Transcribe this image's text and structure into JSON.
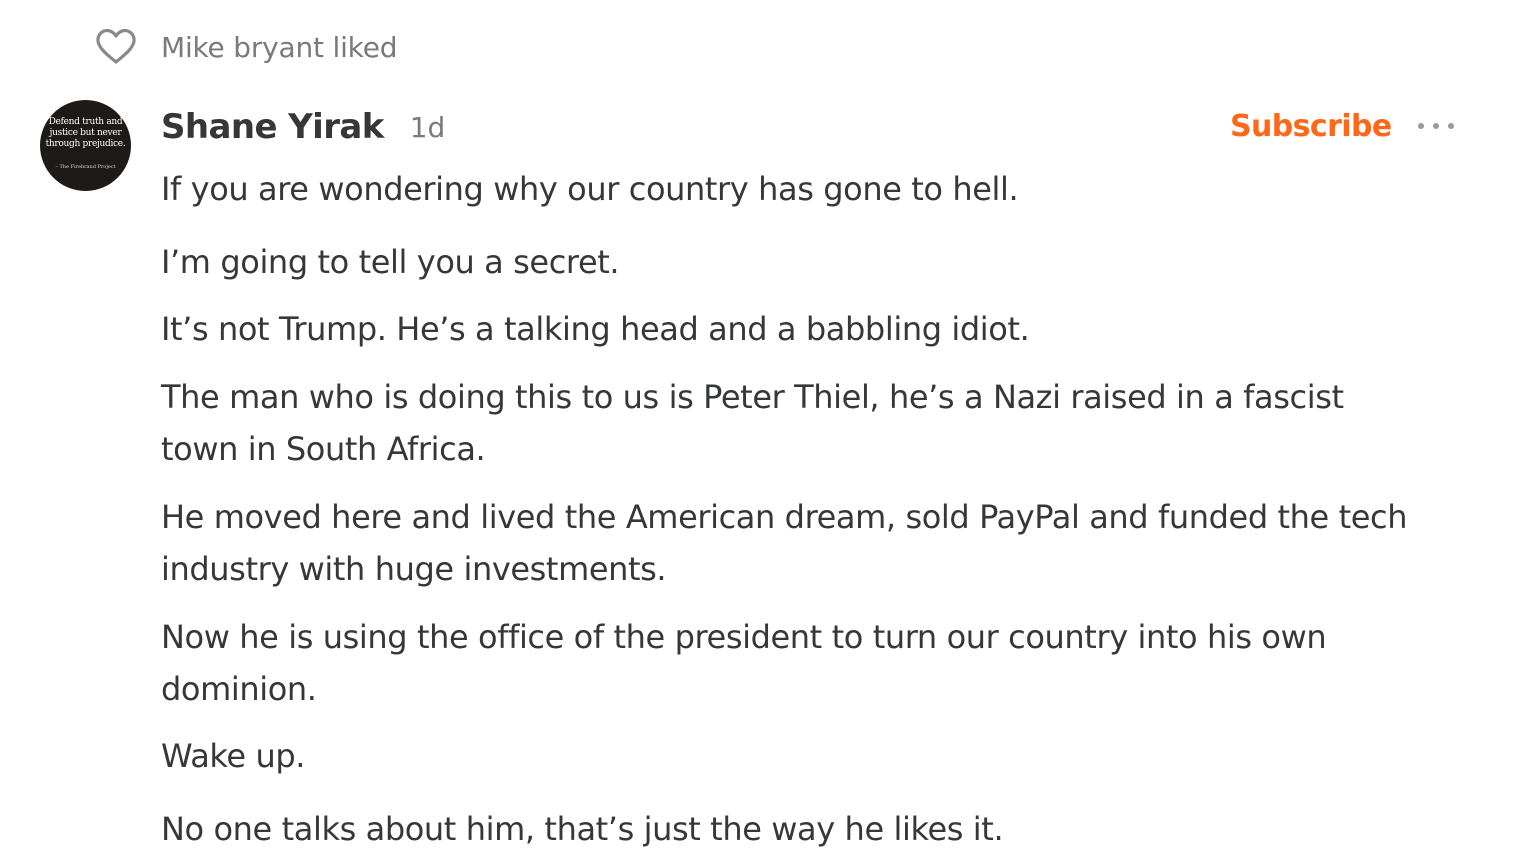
{
  "activity": {
    "icon": "heart-outline-icon",
    "text": "Mike bryant liked"
  },
  "comment": {
    "avatar": {
      "quote": "Defend truth and justice but never through prejudice.",
      "credit": "– The Firebrand Project"
    },
    "author": "Shane Yirak",
    "time": "1d",
    "subscribe_label": "Subscribe",
    "more_icon": "more-horizontal-icon",
    "paragraphs": [
      "If you are wondering why our country has gone to hell.",
      "I’m going to tell you a secret.",
      "It’s not Trump. He’s a talking head and a babbling idiot.",
      "The man who is doing this to us is Peter Thiel, he’s a Nazi raised in a fascist town in South Africa.",
      "He moved here and lived the American dream, sold PayPal and funded the tech industry with huge investments.",
      "Now he is using the office of the president to turn our country into his own dominion.",
      "Wake up.",
      "No one talks about him, that’s just the way he likes it."
    ]
  },
  "colors": {
    "accent": "#ff6719",
    "text": "#363737",
    "muted": "#7a7a7a",
    "avatar_bg": "#1e1a18"
  }
}
